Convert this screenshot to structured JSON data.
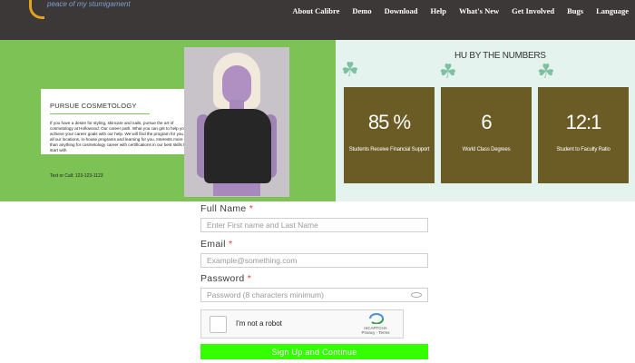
{
  "header": {
    "logo_text": "peace of my stumigament",
    "nav": [
      "About Calibre",
      "Demo",
      "Download",
      "Help",
      "What's New",
      "Get Involved",
      "Bugs",
      "Language"
    ]
  },
  "hero": {
    "card_title": "PURSUE COSMETOLOGY",
    "card_text": "If you have a desire for styling, skincare and nails, pursue the art of cosmetology at Hollowood. Our career path. What you can get to help you achieve your career goals with our help. We will find the program for you in all our locations, in-house programs and learning for you. Interests more than anything for cosmetology career with certifications in our best skills to start with",
    "card_phone": "Text or Call: 123-123-1123"
  },
  "stats": {
    "title": "HU BY THE NUMBERS",
    "items": [
      {
        "value": "85 %",
        "label": "Students Receive Financial Support"
      },
      {
        "value": "6",
        "label": "World Class Degrees"
      },
      {
        "value": "12:1",
        "label": "Student to Faculty Ratio"
      }
    ]
  },
  "form": {
    "full_name_label": "Full Name",
    "full_name_placeholder": "Enter First name and Last Name",
    "email_label": "Email",
    "email_placeholder": "Example@something.com",
    "password_label": "Password",
    "password_placeholder": "Password (8 characters minimum)",
    "required_mark": "*",
    "captcha_text": "I'm not a robot",
    "captcha_brand": "reCAPTCHA",
    "captcha_links": "Privacy - Terms",
    "submit_label": "Sign Up and Continue"
  },
  "colors": {
    "header_bg": "#3d3838",
    "hero_green": "#7cc254",
    "stats_bg": "#e4f3ee",
    "stat_box": "#6b5b24",
    "submit_green": "#33ff00",
    "required_red": "#e53935"
  }
}
